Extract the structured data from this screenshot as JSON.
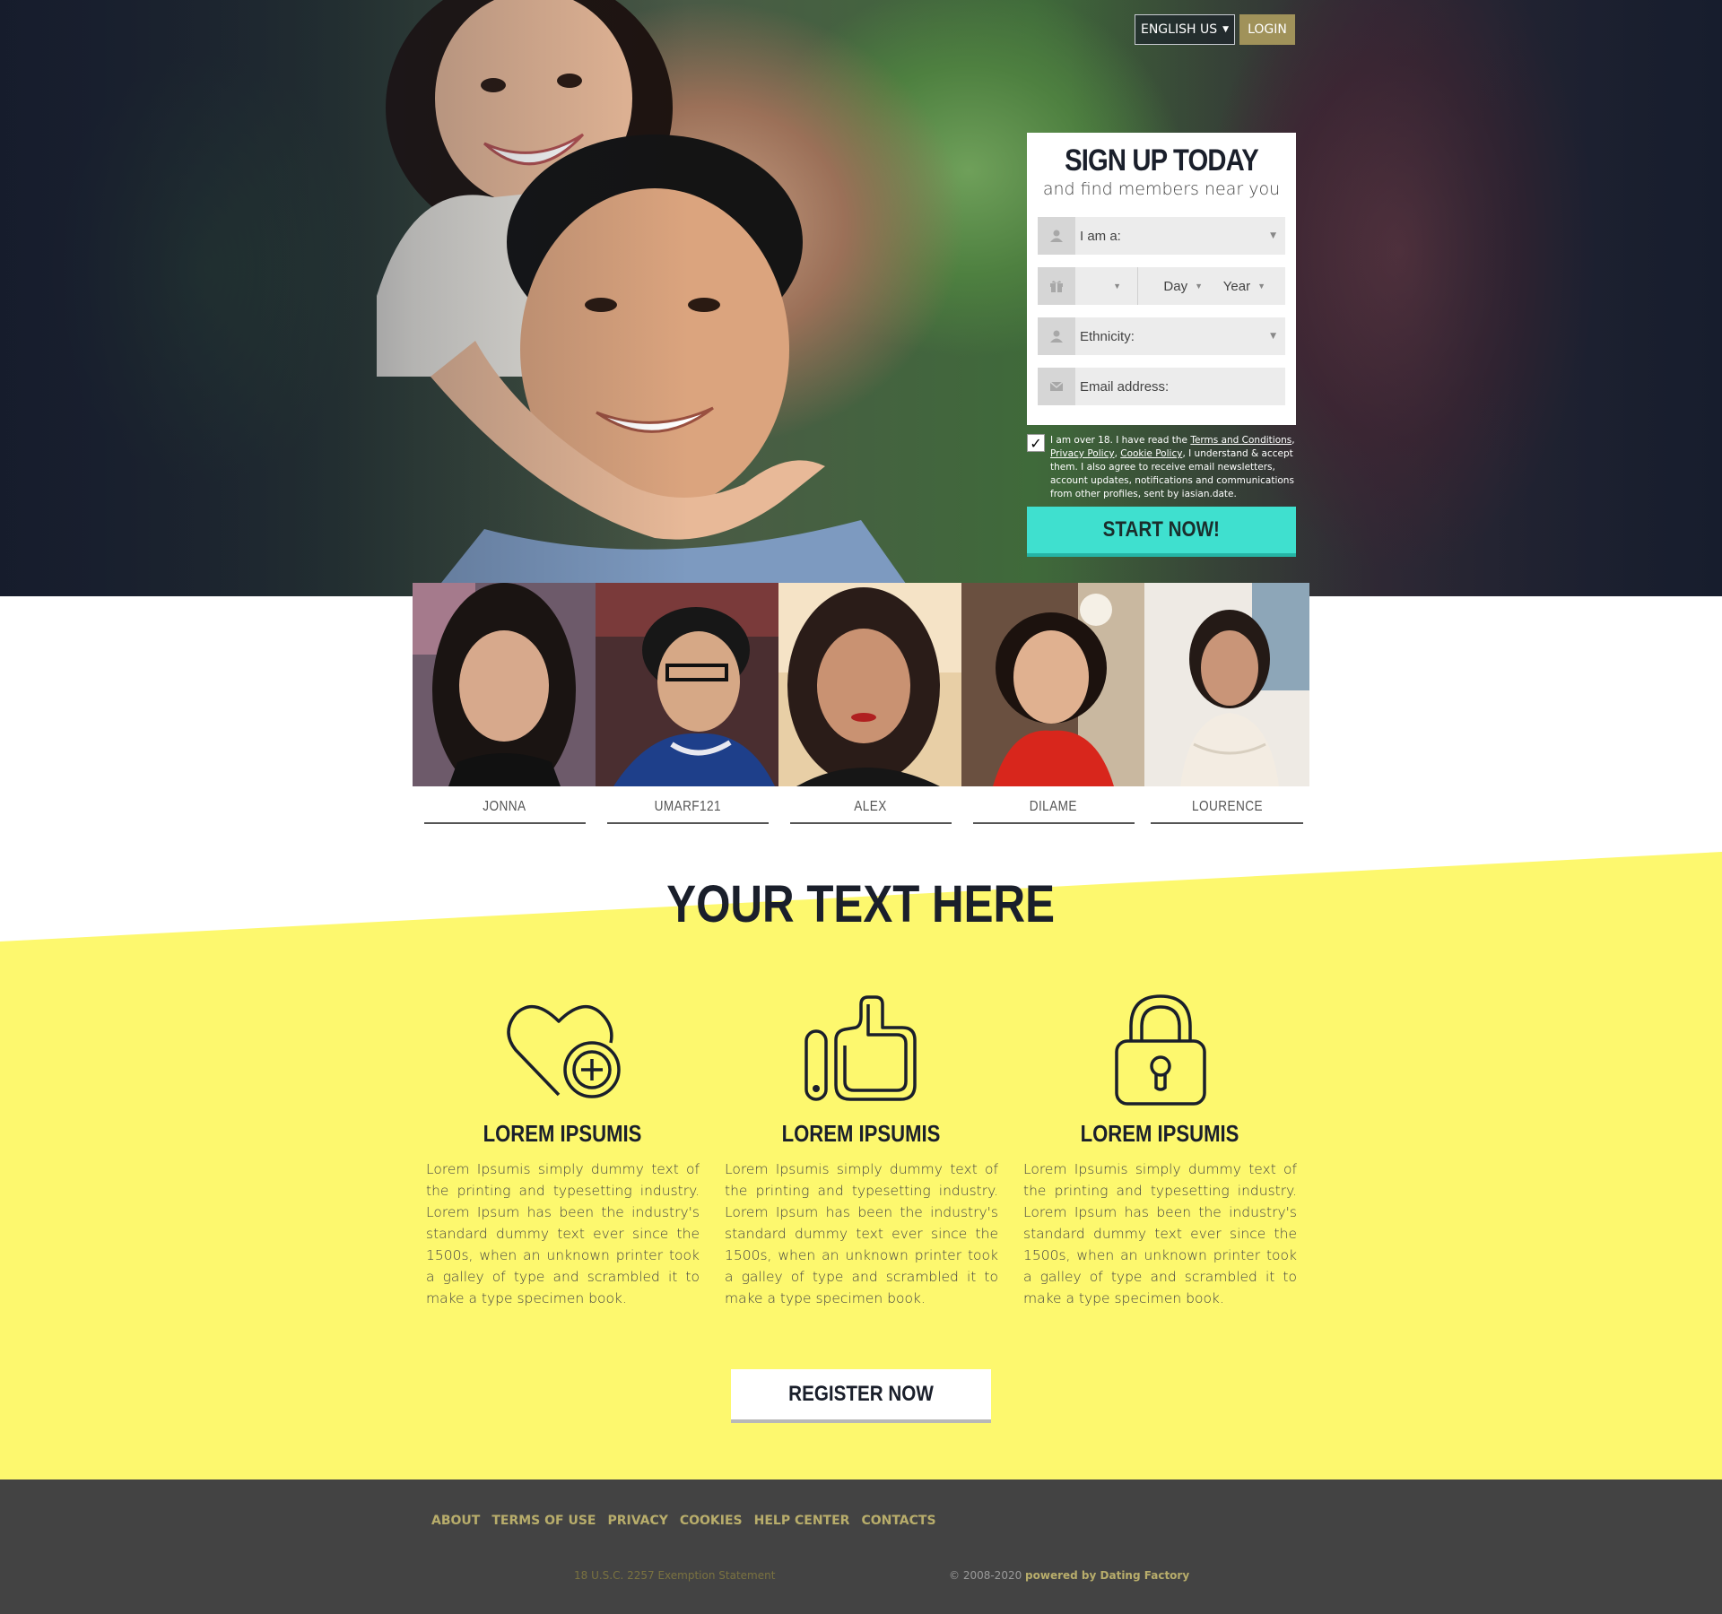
{
  "header": {
    "language_label": "ENGLISH US",
    "login_label": "LOGIN"
  },
  "signup": {
    "title": "SIGN UP TODAY",
    "subtitle": "and find members near you",
    "gender_label": "I am a:",
    "dob_day": "Day",
    "dob_year": "Year",
    "ethnicity_label": "Ethnicity:",
    "email_label": "Email address:",
    "consent_prefix": "I am over 18. I have read the ",
    "terms_link": "Terms and Conditions",
    "sep1": ", ",
    "privacy_link": "Privacy Policy",
    "sep2": ", ",
    "cookie_link": "Cookie Policy",
    "consent_suffix": ", I understand & accept them. I also agree to receive email newsletters, account updates, notifications and communications from other profiles, sent by iasian.date.",
    "submit_label": "START NOW!"
  },
  "profiles": [
    {
      "name": "JONNA"
    },
    {
      "name": "UMARF121"
    },
    {
      "name": "ALEX"
    },
    {
      "name": "DILAME"
    },
    {
      "name": "LOURENCE"
    }
  ],
  "section": {
    "title": "YOUR TEXT HERE"
  },
  "features": [
    {
      "icon": "heart-plus-icon",
      "title": "LOREM IPSUMIS",
      "text": "Lorem Ipsumis simply dummy text of the printing and typesetting industry. Lorem Ipsum has been the industry's standard dummy text ever since the 1500s, when an unknown printer took a galley of type and scrambled it to make a type specimen book."
    },
    {
      "icon": "thumbs-up-icon",
      "title": "LOREM IPSUMIS",
      "text": "Lorem Ipsumis simply dummy text of the printing and typesetting industry. Lorem Ipsum has been the industry's standard dummy text ever since the 1500s, when an unknown printer took a galley of type and scrambled it to make a type specimen book."
    },
    {
      "icon": "padlock-icon",
      "title": "LOREM IPSUMIS",
      "text": "Lorem Ipsumis simply dummy text of the printing and typesetting industry. Lorem Ipsum has been the industry's standard dummy text ever since the 1500s, when an unknown printer took a galley of type and scrambled it to make a type specimen book."
    }
  ],
  "register_label": "REGISTER NOW",
  "footer": {
    "links": [
      "ABOUT",
      "TERMS OF USE",
      "PRIVACY",
      "COOKIES",
      "HELP CENTER",
      "CONTACTS"
    ],
    "exemption": "18 U.S.C. 2257 Exemption Statement",
    "copyright": "© 2008-2020 ",
    "powered": "powered by Dating Factory"
  },
  "colors": {
    "accent_teal": "#3fe0cf",
    "yellow": "#fdf86e",
    "gold": "#a0925a",
    "footer_bg": "#434343",
    "footer_link": "#b8ad6b",
    "dark_text": "#1a1f2b"
  }
}
